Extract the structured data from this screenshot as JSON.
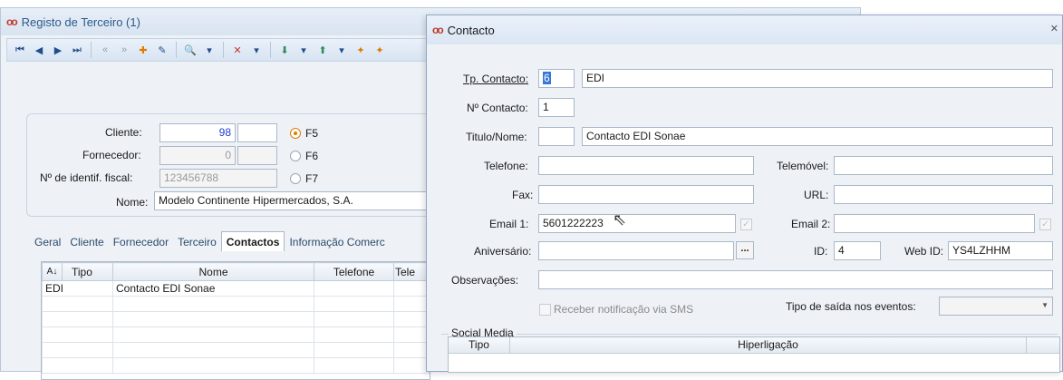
{
  "bg_window": {
    "title": "Registo de Terceiro (1)",
    "fields": {
      "cliente_label": "Cliente:",
      "cliente_value": "98",
      "fornecedor_label": "Fornecedor:",
      "fornecedor_value": "0",
      "nif_label": "Nº de identif. fiscal:",
      "nif_value": "123456788",
      "nome_label": "Nome:",
      "nome_value": "Modelo Continente Hipermercados, S.A."
    },
    "radios": [
      "F5",
      "F6",
      "F7"
    ],
    "tabs": [
      "Geral",
      "Cliente",
      "Fornecedor",
      "Terceiro",
      "Contactos",
      "Informação Comerc"
    ],
    "grid": {
      "columns": [
        "Tipo",
        "Nome",
        "Telefone",
        "Tele"
      ],
      "rows": [
        [
          "EDI",
          "Contacto EDI Sonae",
          "",
          ""
        ]
      ]
    }
  },
  "contact_window": {
    "title": "Contacto",
    "labels": {
      "tp_contacto": "Tp. Contacto:",
      "n_contacto": "Nº Contacto:",
      "titulo_nome": "Titulo/Nome:",
      "telefone": "Telefone:",
      "telemovel": "Telemóvel:",
      "fax": "Fax:",
      "url": "URL:",
      "email1": "Email 1:",
      "email2": "Email 2:",
      "aniversario": "Aniversário:",
      "id": "ID:",
      "web_id": "Web ID:",
      "observacoes": "Observações:",
      "sms": "Receber notificação via SMS",
      "tipo_saida": "Tipo de saída nos eventos:"
    },
    "values": {
      "tp_code": "6",
      "tp_name": "EDI",
      "n_contacto": "1",
      "titulo": "",
      "nome": "Contacto EDI Sonae",
      "telefone": "",
      "telemovel": "",
      "fax": "",
      "url": "",
      "email1": "5601222223",
      "email2": "",
      "aniversario": "",
      "id": "4",
      "web_id": "YS4LZHHM",
      "observacoes": ""
    },
    "aniversario_button": "...",
    "social_media": {
      "legend": "Social Media",
      "columns": [
        "Tipo",
        "Hiperligação"
      ]
    }
  }
}
